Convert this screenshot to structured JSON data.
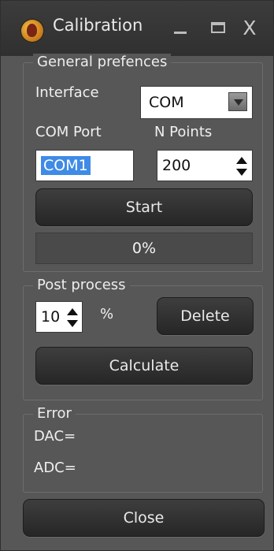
{
  "window": {
    "title": "Calibration",
    "icon": "app-logo-icon"
  },
  "titlebar_buttons": {
    "minimize": "minimize-icon",
    "maximize": "maximize-icon",
    "close": "close-icon",
    "close_glyph": "X"
  },
  "general": {
    "legend": "General prefences",
    "interface_label": "Interface",
    "interface_value": "COM",
    "comport_label": "COM Port",
    "comport_value": "COM1",
    "npoints_label": "N Points",
    "npoints_value": "200",
    "start_label": "Start",
    "progress": {
      "value": 0,
      "text": "0%"
    }
  },
  "post": {
    "legend": "Post process",
    "spin_value": "10",
    "unit": "%",
    "delete_label": "Delete",
    "calculate_label": "Calculate"
  },
  "error": {
    "legend": "Error",
    "dac_label": "DAC=",
    "adc_label": "ADC="
  },
  "footer": {
    "close_label": "Close"
  },
  "colors": {
    "accent": "#3f8be6",
    "window_bg": "#575757",
    "title_bg": "#303030"
  }
}
